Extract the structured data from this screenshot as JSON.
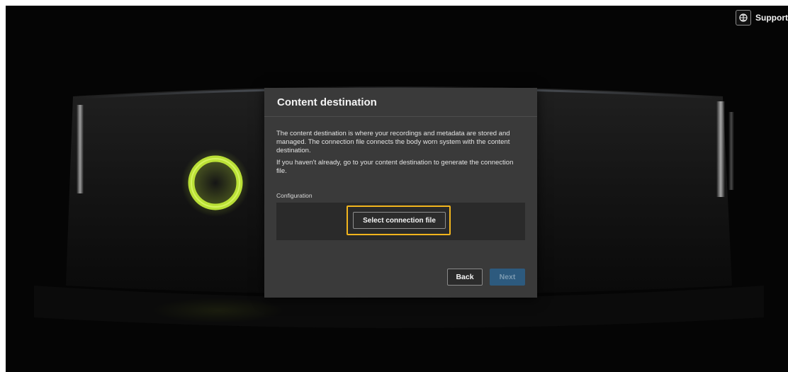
{
  "header": {
    "support_label": "Support",
    "support_icon": "globe-icon"
  },
  "dialog": {
    "title": "Content destination",
    "paragraph_1": "The content destination is where your recordings and metadata are stored and managed. The connection file connects the body worn system with the content destination.",
    "paragraph_2": "If you haven't already, go to your content destination to generate the connection file.",
    "configuration_label": "Configuration",
    "select_button_label": "Select connection file",
    "back_label": "Back",
    "next_label": "Next"
  },
  "colors": {
    "highlight": "#f2b51d",
    "ring": "#c9f23a",
    "primary_disabled": "#2d5a7e"
  }
}
